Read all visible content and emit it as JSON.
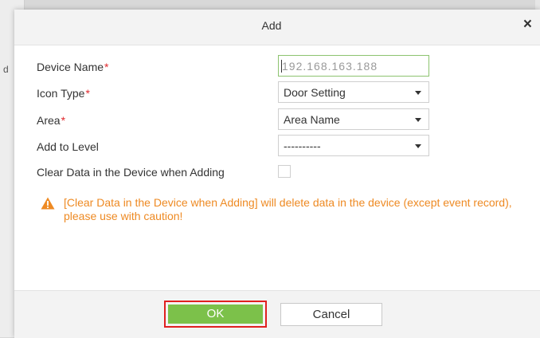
{
  "dialog": {
    "title": "Add",
    "close_glyph": "×"
  },
  "background": {
    "left_fragment": "d",
    "right_fragment": "·"
  },
  "form": {
    "required_mark": "*",
    "device_name": {
      "label": "Device Name",
      "value": "192.168.163.188",
      "required": true
    },
    "icon_type": {
      "label": "Icon Type",
      "value": "Door Setting",
      "required": true
    },
    "area": {
      "label": "Area",
      "value": "Area Name",
      "required": true
    },
    "add_to_level": {
      "label": "Add to Level",
      "value": "----------"
    },
    "clear_data": {
      "label": "Clear Data in the Device when Adding",
      "checked": false
    }
  },
  "warning": {
    "icon": "warning-triangle-icon",
    "text": "[Clear Data in the Device when Adding] will delete data in the device (except event record), please use with caution!"
  },
  "buttons": {
    "ok": "OK",
    "cancel": "Cancel"
  },
  "colors": {
    "ok_green": "#7cc14a",
    "highlight_red": "#e02020",
    "warning_orange": "#ee8a23",
    "required_red": "#e0282d",
    "input_focus_green": "#8cc36f"
  }
}
